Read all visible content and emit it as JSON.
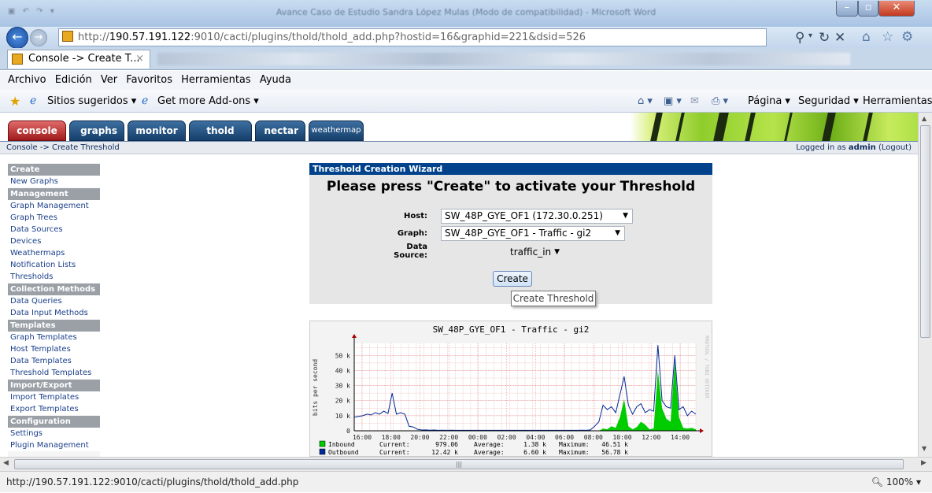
{
  "window": {
    "title": "Avance Caso de Estudio Sandra López Mulas (Modo de compatibilidad) - Microsoft Word",
    "qat": "▣ ↶ ↷ ▾"
  },
  "address": {
    "host_part": "http://",
    "host": "190.57.191.122",
    "rest": ":9010/cacti/plugins/thold/thold_add.php?hostid=16&graphid=221&dsid=526"
  },
  "tab": {
    "title": "Console -> Create T...",
    "close": "×"
  },
  "menu": [
    "Archivo",
    "Edición",
    "Ver",
    "Favoritos",
    "Herramientas",
    "Ayuda"
  ],
  "favorites": {
    "suggested": "Sitios sugeridos ▾",
    "addons": "Get more Add-ons ▾"
  },
  "commandbar": {
    "page": "Página ▾",
    "security": "Seguridad ▾",
    "tools": "Herramientas ▾"
  },
  "cacti_tabs": [
    "console",
    "graphs",
    "monitor",
    "thold",
    "nectar",
    "weathermap"
  ],
  "breadcrumb": {
    "text": "Console -> Create Threshold",
    "logged_prefix": "Logged in as ",
    "user": "admin",
    "logout": "(Logout)"
  },
  "sidebar": [
    {
      "type": "header",
      "label": "Create"
    },
    {
      "type": "item",
      "label": "New Graphs"
    },
    {
      "type": "header",
      "label": "Management"
    },
    {
      "type": "item",
      "label": "Graph Management"
    },
    {
      "type": "item",
      "label": "Graph Trees"
    },
    {
      "type": "item",
      "label": "Data Sources"
    },
    {
      "type": "item",
      "label": "Devices"
    },
    {
      "type": "item",
      "label": "Weathermaps"
    },
    {
      "type": "item",
      "label": "Notification Lists"
    },
    {
      "type": "item",
      "label": "Thresholds"
    },
    {
      "type": "header",
      "label": "Collection Methods"
    },
    {
      "type": "item",
      "label": "Data Queries"
    },
    {
      "type": "item",
      "label": "Data Input Methods"
    },
    {
      "type": "header",
      "label": "Templates"
    },
    {
      "type": "item",
      "label": "Graph Templates"
    },
    {
      "type": "item",
      "label": "Host Templates"
    },
    {
      "type": "item",
      "label": "Data Templates"
    },
    {
      "type": "item",
      "label": "Threshold Templates"
    },
    {
      "type": "header",
      "label": "Import/Export"
    },
    {
      "type": "item",
      "label": "Import Templates"
    },
    {
      "type": "item",
      "label": "Export Templates"
    },
    {
      "type": "header",
      "label": "Configuration"
    },
    {
      "type": "item",
      "label": "Settings"
    },
    {
      "type": "item",
      "label": "Plugin Management"
    }
  ],
  "wizard": {
    "header": "Threshold Creation Wizard",
    "heading": "Please press \"Create\" to activate your Threshold",
    "host_label": "Host:",
    "host_value": "SW_48P_GYE_OF1 (172.30.0.251)",
    "graph_label": "Graph:",
    "graph_value": "SW_48P_GYE_OF1 - Traffic - gi2",
    "ds_label_1": "Data",
    "ds_label_2": "Source:",
    "ds_value": "traffic_in",
    "create": "Create",
    "tooltip": "Create Threshold"
  },
  "chart_data": {
    "type": "area",
    "title": "SW_48P_GYE_OF1 - Traffic - gi2",
    "ylabel": "bits per second",
    "side_label": "RRDTOOL / TOBI OETIKER",
    "ylim": [
      0,
      58000
    ],
    "y_ticks": [
      "0",
      "10 k",
      "20 k",
      "30 k",
      "40 k",
      "50 k"
    ],
    "x_ticks": [
      "16:00",
      "18:00",
      "20:00",
      "22:00",
      "00:00",
      "02:00",
      "04:00",
      "06:00",
      "08:00",
      "10:00",
      "12:00",
      "14:00"
    ],
    "series": [
      {
        "name": "Inbound",
        "color": "#00cc00",
        "style": "area",
        "values": [
          0,
          0,
          0,
          0,
          0,
          0,
          0,
          0,
          0,
          0,
          0,
          0,
          0,
          0,
          0,
          0,
          0,
          0,
          0,
          0,
          0,
          0,
          0,
          0,
          0,
          0,
          0,
          0,
          0,
          0,
          0,
          0,
          0,
          0,
          0,
          0,
          0,
          0,
          0,
          0,
          0,
          0,
          0,
          0,
          0,
          0,
          0,
          0,
          0,
          0,
          0,
          0,
          0,
          0,
          0,
          0,
          0,
          0,
          0,
          1500,
          1000,
          3000,
          2000,
          9000,
          21000,
          3000,
          1000,
          2500,
          6000,
          4000,
          1000,
          1500,
          40000,
          15000,
          8000,
          6000,
          46000,
          9000,
          2000,
          1500,
          2000,
          1000
        ]
      },
      {
        "name": "Outbound",
        "color": "#002a97",
        "style": "line",
        "values": [
          9000,
          9500,
          10000,
          11000,
          10500,
          12000,
          11000,
          13000,
          11500,
          25000,
          11000,
          12000,
          11000,
          3000,
          2500,
          1000,
          500,
          600,
          400,
          500,
          300,
          400,
          300,
          400,
          300,
          300,
          300,
          300,
          300,
          300,
          300,
          300,
          300,
          300,
          300,
          300,
          300,
          300,
          300,
          300,
          300,
          300,
          300,
          300,
          300,
          300,
          300,
          300,
          300,
          300,
          300,
          300,
          300,
          300,
          400,
          300,
          600,
          3000,
          6000,
          17000,
          14000,
          16000,
          12000,
          24000,
          36000,
          17000,
          11000,
          16000,
          18000,
          12000,
          14000,
          13000,
          56780,
          20000,
          16000,
          15000,
          50000,
          14000,
          16000,
          10000,
          13000,
          11000
        ]
      }
    ],
    "legend": [
      {
        "name": "Inbound",
        "color": "#00cc00",
        "current_label": "Current:",
        "current": "979.06",
        "average_label": "Average:",
        "average": "1.38 k",
        "maximum_label": "Maximum:",
        "maximum": "46.51 k"
      },
      {
        "name": "Outbound",
        "color": "#002a97",
        "current_label": "Current:",
        "current": "12.42 k",
        "average_label": "Average:",
        "average": "6.60 k",
        "maximum_label": "Maximum:",
        "maximum": "56.78 k"
      }
    ]
  },
  "status": {
    "url": "http://190.57.191.122:9010/cacti/plugins/thold/thold_add.php",
    "zoom": "100%"
  }
}
